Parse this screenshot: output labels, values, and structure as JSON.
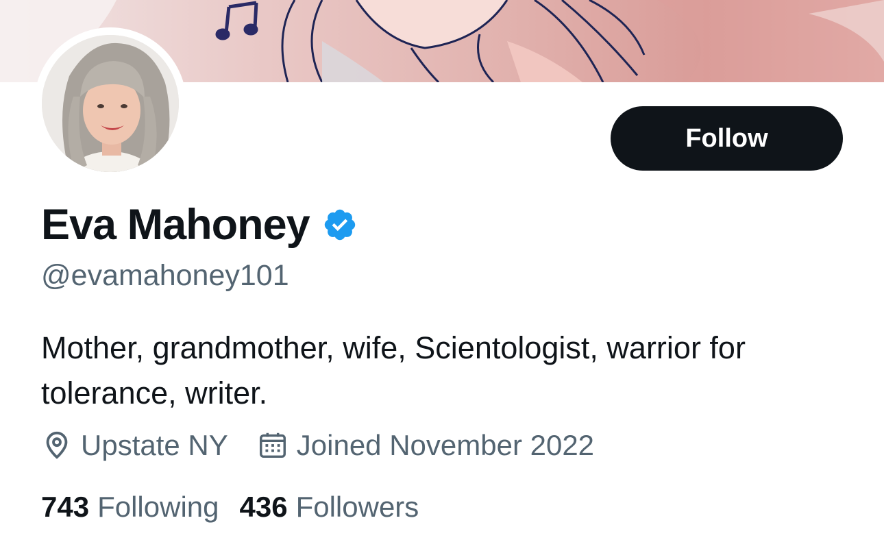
{
  "profile": {
    "display_name": "Eva Mahoney",
    "handle": "@evamahoney101",
    "bio": "Mother, grandmother, wife, Scientologist, warrior for tolerance, writer.",
    "verified": true,
    "location": "Upstate NY",
    "joined": "Joined November 2022"
  },
  "actions": {
    "follow_label": "Follow"
  },
  "stats": {
    "following_count": "743",
    "following_label": "Following",
    "followers_count": "436",
    "followers_label": "Followers"
  },
  "icons": {
    "verified": "verified-badge-icon",
    "location": "location-pin-icon",
    "calendar": "calendar-icon"
  },
  "colors": {
    "text_primary": "#0f1419",
    "text_secondary": "#536471",
    "verified_blue": "#1d9bf0",
    "follow_button_bg": "#0f1419"
  }
}
